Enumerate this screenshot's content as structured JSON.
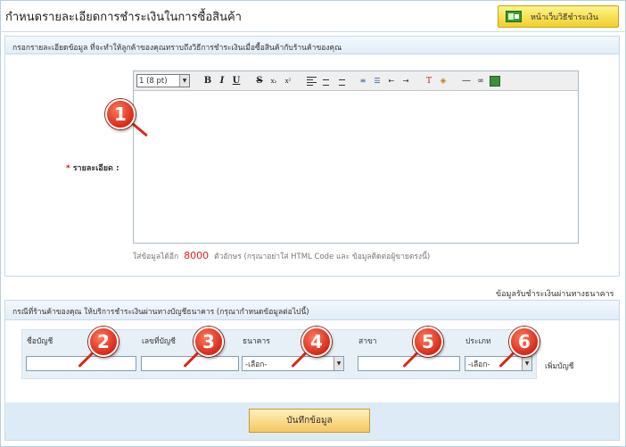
{
  "page": {
    "title": "กำหนดรายละเอียดการชำระเงินในการซื้อสินค้า",
    "help_button": {
      "label": "หน้าเว็บวิธีชำระเงิน",
      "icon": "payment-page-icon"
    }
  },
  "details_section": {
    "header": "กรอกรายละเอียดข้อมูล ที่จะทำให้ลูกค้าของคุณทราบถึงวิธีการชำระเงินเมื่อซื้อสินค้ากับร้านค้าของคุณ",
    "field_label": "รายละเอียด :",
    "required_marker": "*",
    "editor": {
      "font_size": "1 (8 pt)",
      "buttons": [
        "B",
        "I",
        "U",
        "S",
        "x₂",
        "x²"
      ],
      "content": ""
    },
    "hint_prefix": "ใส่ข้อมูลได้อีก",
    "hint_count": "8000",
    "hint_suffix": "ตัวอักษร (กรุณาอย่าใส่ HTML Code และ ข้อมูลติดต่อผู้ขายตรงนี้)"
  },
  "bank_section": {
    "caption": "ข้อมูลรับชำระเงินผ่านทางธนาคาร",
    "header": "กรณีที่ร้านค้าของคุณ ให้บริการชำระเงินผ่านทางบัญชีธนาคาร (กรุณากำหนดข้อมูลต่อไปนี้)",
    "columns": {
      "account_name": "ชื่อบัญชี",
      "account_number": "เลขที่บัญชี",
      "bank": "ธนาคาร",
      "branch": "สาขา",
      "type": "ประเภท"
    },
    "bank_select": "-เลือก-",
    "type_select": "-เลือก-",
    "add_account": "เพิ่มบัญชี",
    "save_button": "บันทึกข้อมูล"
  },
  "markers": [
    "1",
    "2",
    "3",
    "4",
    "5",
    "6"
  ],
  "colors": {
    "marker": "#d8291a",
    "help_button": "#f5d63a",
    "save_button": "#f5c862",
    "hint_count": "#e02020"
  }
}
